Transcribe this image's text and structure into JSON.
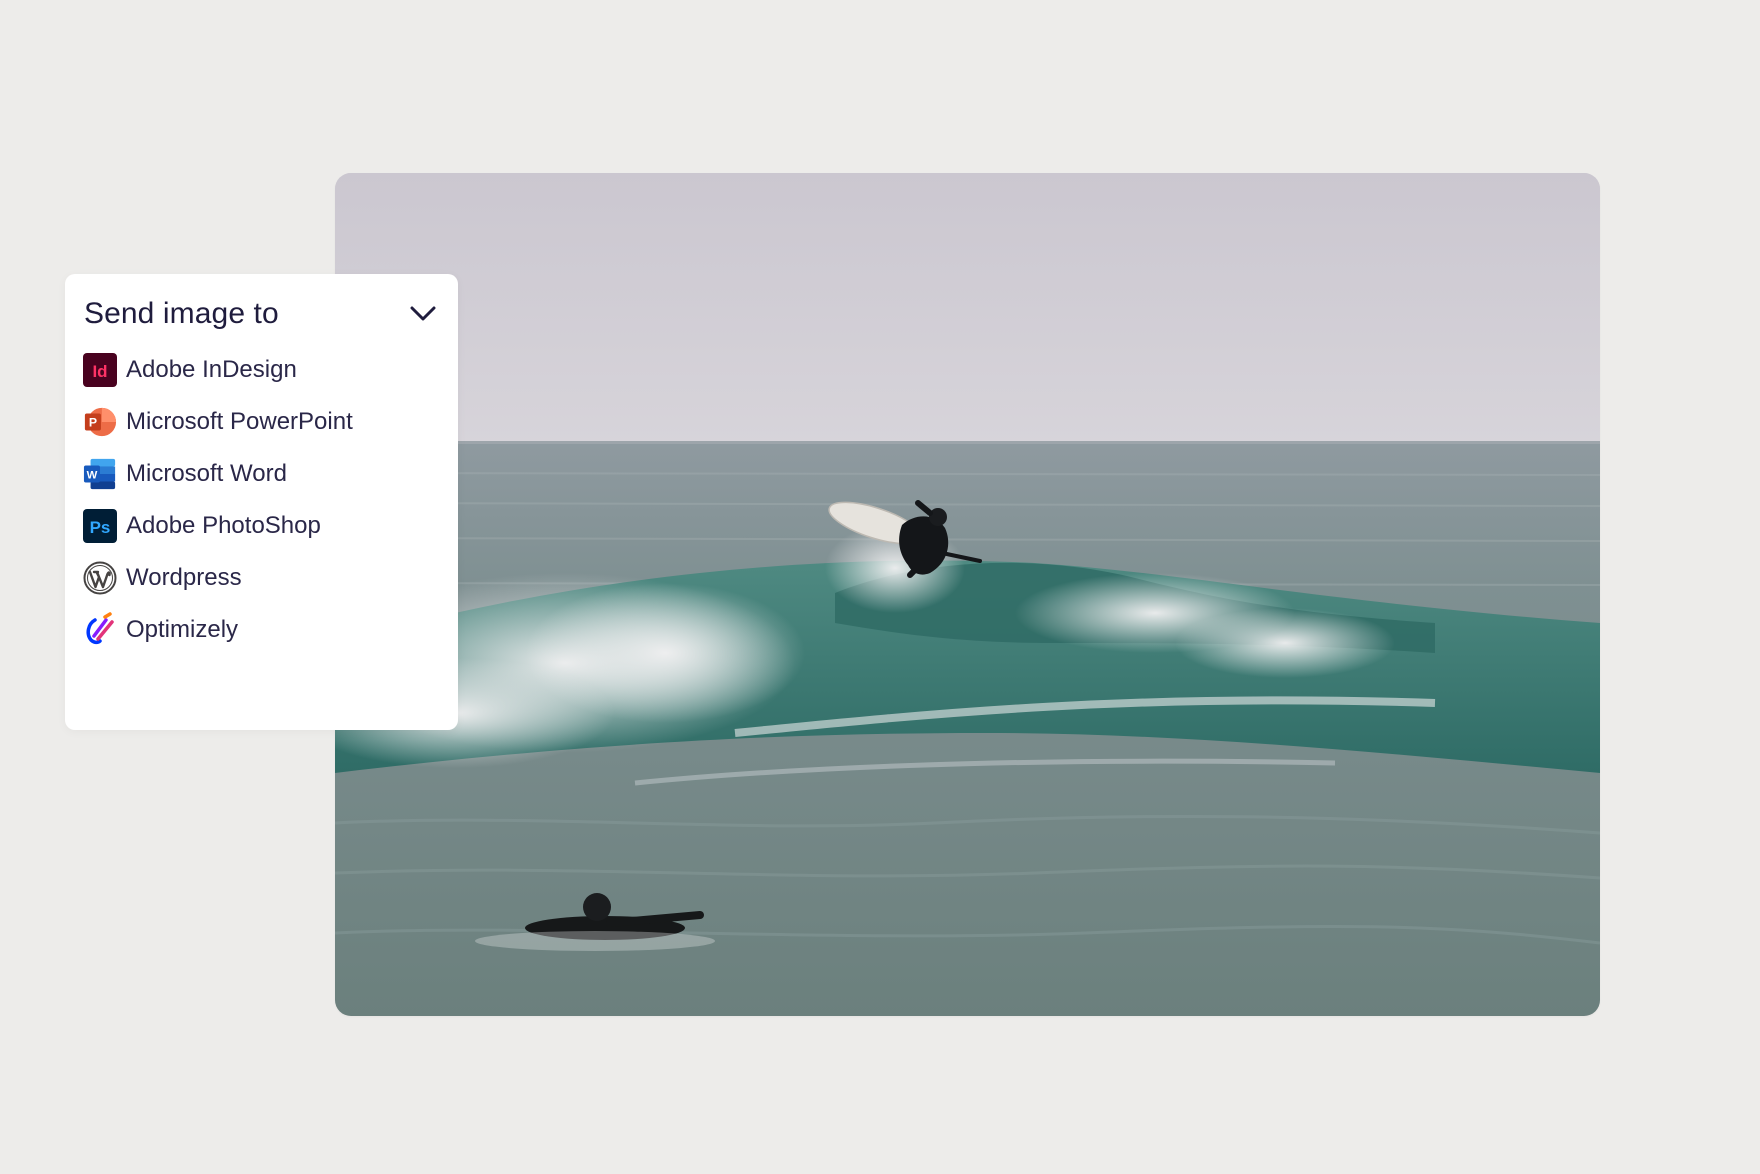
{
  "panel": {
    "title": "Send image to",
    "expand_icon": "chevron-down-icon",
    "items": [
      {
        "label": "Adobe InDesign",
        "icon": "adobe-indesign-icon",
        "icon_text": "Id",
        "color": "#49021f",
        "accent": "#ff3366"
      },
      {
        "label": "Microsoft PowerPoint",
        "icon": "microsoft-powerpoint-icon",
        "icon_text": "P",
        "color": "#c43e1c",
        "accent": "#ff8f6b"
      },
      {
        "label": "Microsoft Word",
        "icon": "microsoft-word-icon",
        "icon_text": "W",
        "color": "#185abd",
        "accent": "#41a5ee"
      },
      {
        "label": "Adobe PhotoShop",
        "icon": "adobe-photoshop-icon",
        "icon_text": "Ps",
        "color": "#001e36",
        "accent": "#31a8ff"
      },
      {
        "label": "Wordpress",
        "icon": "wordpress-icon",
        "icon_text": "W",
        "color": "#464342",
        "accent": "#464342"
      },
      {
        "label": "Optimizely",
        "icon": "optimizely-icon",
        "color": "#0037ff",
        "accent": "#e2347a"
      }
    ]
  },
  "photo": {
    "subject": "surfing-photo"
  }
}
